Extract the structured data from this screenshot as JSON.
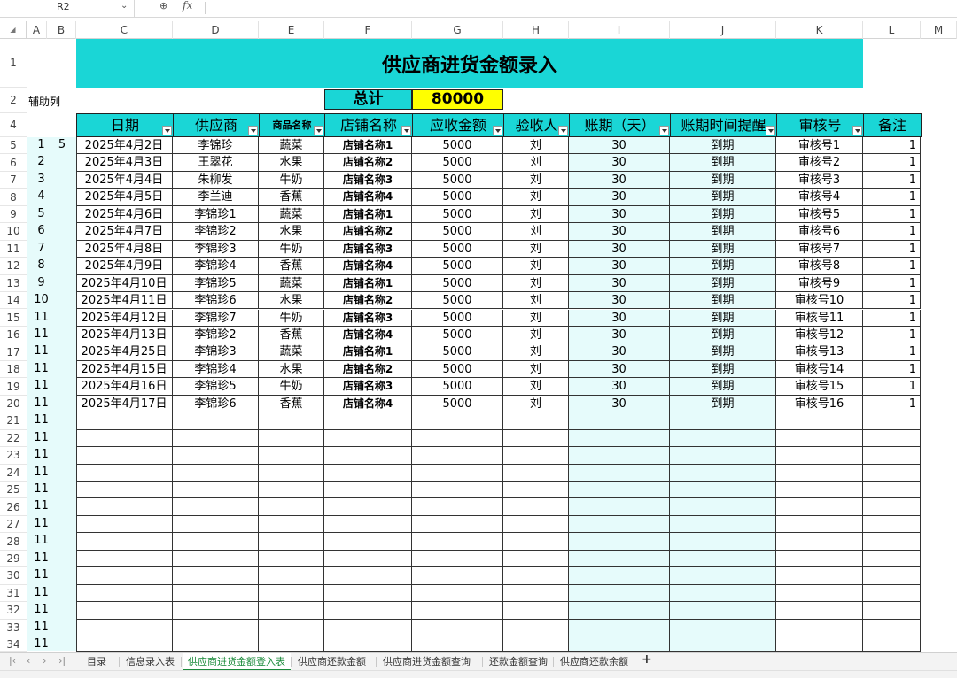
{
  "name_box": {
    "value": "R2"
  },
  "formula_bar": {
    "fx_label": "fx",
    "value": ""
  },
  "columns": [
    "A",
    "B",
    "C",
    "D",
    "E",
    "F",
    "G",
    "H",
    "I",
    "J",
    "K",
    "L",
    "M"
  ],
  "rows_visible": [
    "1",
    "2",
    "4",
    "5",
    "6",
    "7",
    "8",
    "9",
    "10",
    "11",
    "12",
    "13",
    "14",
    "15",
    "16",
    "17",
    "18",
    "19",
    "20",
    "21",
    "22",
    "23",
    "24",
    "25",
    "26",
    "27",
    "28",
    "29",
    "30",
    "31",
    "32",
    "33",
    "34"
  ],
  "title": "供应商进货金额录入",
  "aux_label": "辅助列",
  "summary": {
    "label": "总计",
    "value": "80000"
  },
  "headers": [
    "日期",
    "供应商",
    "商品名称",
    "店铺名称",
    "应收金额",
    "验收人",
    "账期（天）",
    "账期时间提醒",
    "审核号",
    "备注"
  ],
  "aux_values": [
    "1",
    "2",
    "3",
    "4",
    "5",
    "6",
    "7",
    "8",
    "9",
    "10",
    "11",
    "11",
    "11",
    "11",
    "11",
    "11",
    "11",
    "11",
    "11",
    "11",
    "11",
    "11",
    "11",
    "11",
    "11",
    "11",
    "11",
    "11",
    "11",
    "11"
  ],
  "aux_extra": "5",
  "records": [
    [
      "2025年4月2日",
      "李锦珍",
      "蔬菜",
      "店铺名称1",
      "5000",
      "刘",
      "30",
      "到期",
      "审核号1",
      "1"
    ],
    [
      "2025年4月3日",
      "王翠花",
      "水果",
      "店铺名称2",
      "5000",
      "刘",
      "30",
      "到期",
      "审核号2",
      "1"
    ],
    [
      "2025年4月4日",
      "朱柳发",
      "牛奶",
      "店铺名称3",
      "5000",
      "刘",
      "30",
      "到期",
      "审核号3",
      "1"
    ],
    [
      "2025年4月5日",
      "李兰迪",
      "香蕉",
      "店铺名称4",
      "5000",
      "刘",
      "30",
      "到期",
      "审核号4",
      "1"
    ],
    [
      "2025年4月6日",
      "李锦珍1",
      "蔬菜",
      "店铺名称1",
      "5000",
      "刘",
      "30",
      "到期",
      "审核号5",
      "1"
    ],
    [
      "2025年4月7日",
      "李锦珍2",
      "水果",
      "店铺名称2",
      "5000",
      "刘",
      "30",
      "到期",
      "审核号6",
      "1"
    ],
    [
      "2025年4月8日",
      "李锦珍3",
      "牛奶",
      "店铺名称3",
      "5000",
      "刘",
      "30",
      "到期",
      "审核号7",
      "1"
    ],
    [
      "2025年4月9日",
      "李锦珍4",
      "香蕉",
      "店铺名称4",
      "5000",
      "刘",
      "30",
      "到期",
      "审核号8",
      "1"
    ],
    [
      "2025年4月10日",
      "李锦珍5",
      "蔬菜",
      "店铺名称1",
      "5000",
      "刘",
      "30",
      "到期",
      "审核号9",
      "1"
    ],
    [
      "2025年4月11日",
      "李锦珍6",
      "水果",
      "店铺名称2",
      "5000",
      "刘",
      "30",
      "到期",
      "审核号10",
      "1"
    ],
    [
      "2025年4月12日",
      "李锦珍7",
      "牛奶",
      "店铺名称3",
      "5000",
      "刘",
      "30",
      "到期",
      "审核号11",
      "1"
    ],
    [
      "2025年4月13日",
      "李锦珍2",
      "香蕉",
      "店铺名称4",
      "5000",
      "刘",
      "30",
      "到期",
      "审核号12",
      "1"
    ],
    [
      "2025年4月25日",
      "李锦珍3",
      "蔬菜",
      "店铺名称1",
      "5000",
      "刘",
      "30",
      "到期",
      "审核号13",
      "1"
    ],
    [
      "2025年4月15日",
      "李锦珍4",
      "水果",
      "店铺名称2",
      "5000",
      "刘",
      "30",
      "到期",
      "审核号14",
      "1"
    ],
    [
      "2025年4月16日",
      "李锦珍5",
      "牛奶",
      "店铺名称3",
      "5000",
      "刘",
      "30",
      "到期",
      "审核号15",
      "1"
    ],
    [
      "2025年4月17日",
      "李锦珍6",
      "香蕉",
      "店铺名称4",
      "5000",
      "刘",
      "30",
      "到期",
      "审核号16",
      "1"
    ]
  ],
  "sheet_tabs": [
    "目录",
    "信息录入表",
    "供应商进货金额登入表",
    "供应商还款金额",
    "供应商进货金额查询",
    "还款金额查询",
    "供应商还款余额"
  ],
  "active_tab": "供应商进货金额登入表",
  "add_tab": "+",
  "colors": {
    "header_fill": "#1ad6d6",
    "total_fill": "#ffff00",
    "tint": "#e6fbfb",
    "active_tab": "#1a8a3a"
  }
}
